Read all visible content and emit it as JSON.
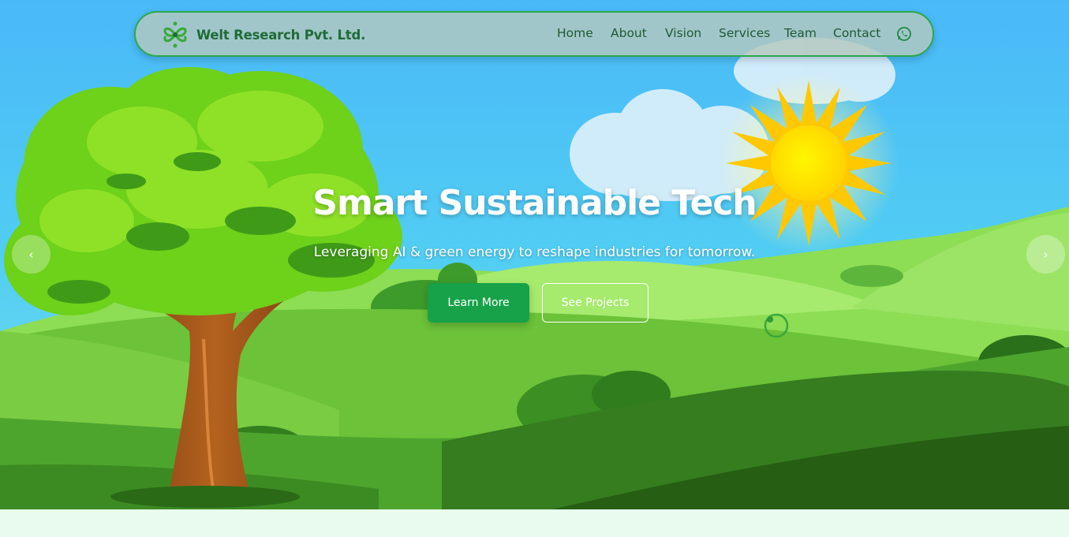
{
  "brand": {
    "name": "Welt Research Pvt. Ltd.",
    "logo_icon": "leaf-knot-icon"
  },
  "nav": {
    "links": [
      "Home",
      "About",
      "Vision",
      "Services",
      "Team",
      "Contact"
    ],
    "whatsapp_icon": "whatsapp-icon"
  },
  "hero": {
    "title": "Smart Sustainable Tech",
    "subtitle": "Leveraging AI & green energy to reshape industries for tomorrow.",
    "primary_button": "Learn More",
    "secondary_button": "See Projects",
    "prev_label": "‹",
    "next_label": "›"
  },
  "colors": {
    "accent": "#17a24a",
    "brand_text": "#1f6b38",
    "sky": "#4fc3f7",
    "grass": "#6cc238"
  }
}
